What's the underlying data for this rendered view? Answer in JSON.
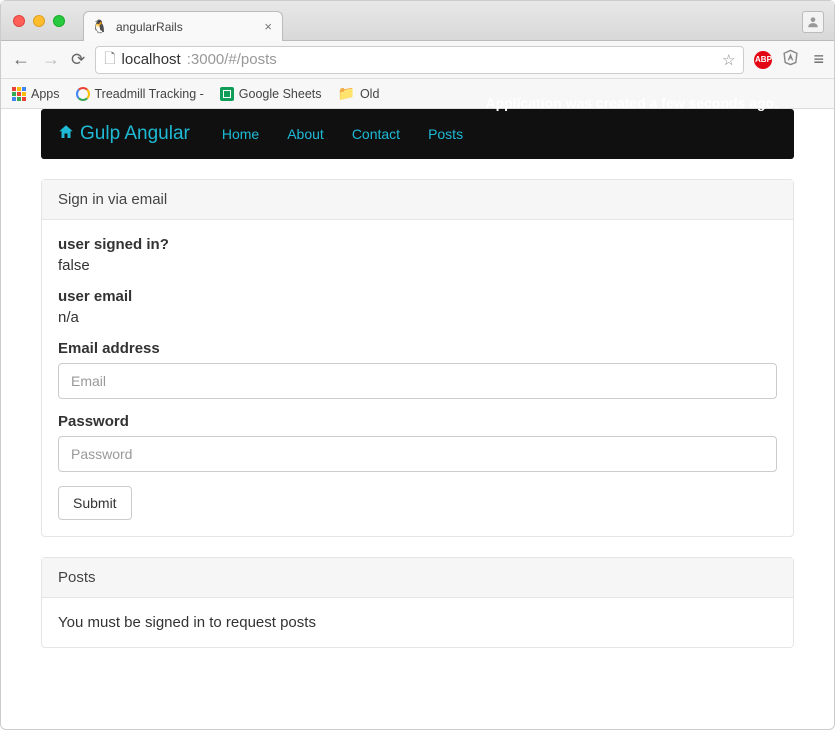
{
  "window": {
    "tab_title": "angularRails"
  },
  "address": {
    "host": "localhost",
    "port_path": ":3000/#/posts"
  },
  "bookmarks": {
    "apps": "Apps",
    "treadmill": "Treadmill Tracking -",
    "sheets": "Google Sheets",
    "old": "Old"
  },
  "extensions": {
    "abp": "ABP"
  },
  "navbar": {
    "brand": "Gulp Angular",
    "links": {
      "home": "Home",
      "about": "About",
      "contact": "Contact",
      "posts": "Posts"
    },
    "alert": "Application was created a few seconds ago."
  },
  "signin_panel": {
    "header": "Sign in via email",
    "signed_in_label": "user signed in?",
    "signed_in_value": "false",
    "user_email_label": "user email",
    "user_email_value": "n/a",
    "email_label": "Email address",
    "email_placeholder": "Email",
    "password_label": "Password",
    "password_placeholder": "Password",
    "submit_label": "Submit"
  },
  "posts_panel": {
    "header": "Posts",
    "message": "You must be signed in to request posts"
  }
}
